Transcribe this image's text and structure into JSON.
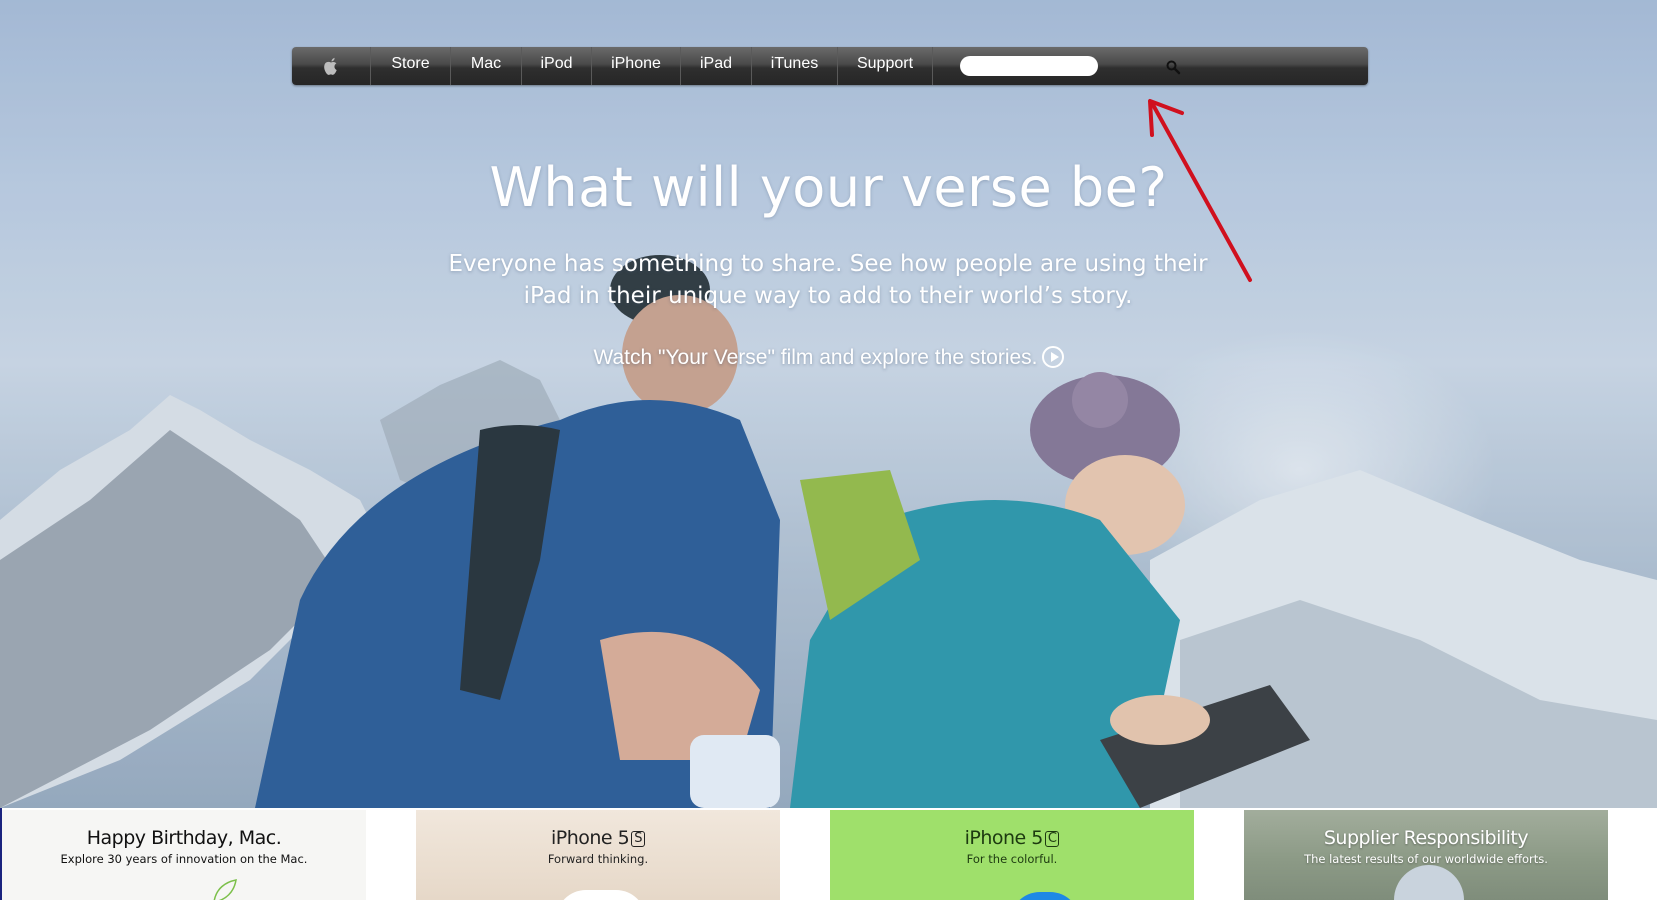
{
  "nav": {
    "apple_icon": "apple-icon",
    "items": [
      {
        "label": "Store"
      },
      {
        "label": "Mac"
      },
      {
        "label": "iPod"
      },
      {
        "label": "iPhone"
      },
      {
        "label": "iPad"
      },
      {
        "label": "iTunes"
      },
      {
        "label": "Support"
      }
    ],
    "search": {
      "value": "",
      "placeholder": "",
      "icon": "search-icon"
    }
  },
  "hero": {
    "headline": "What will your verse be?",
    "subhead_line1": "Everyone has something to share. See how people are using their",
    "subhead_line2": "iPad in their unique way to add to their world’s story.",
    "watch_link": "Watch \"Your Verse\" film and explore the stories.",
    "watch_icon": "play-circle-icon"
  },
  "annotation": {
    "icon": "red-arrow-icon",
    "color": "#d0101e"
  },
  "tiles": [
    {
      "title": "Happy Birthday, Mac.",
      "subtitle": "Explore 30 years of innovation on the Mac."
    },
    {
      "title": "iPhone 5",
      "badge": "S",
      "subtitle": "Forward thinking."
    },
    {
      "title": "iPhone 5",
      "badge": "C",
      "subtitle": "For the colorful."
    },
    {
      "title": "Supplier Responsibility",
      "subtitle": "The latest results of our worldwide efforts."
    }
  ],
  "colors": {
    "nav_bg": "#2f2f2f",
    "tile_5c": "#9fe06b",
    "sky": "#b3c5dc"
  }
}
